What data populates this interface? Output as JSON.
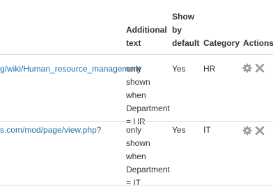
{
  "table": {
    "headers": {
      "url": "",
      "additional_text": "Additional text",
      "show_by_default": "Show by default",
      "category": "Category",
      "actions": "Actions"
    },
    "rows": [
      {
        "url": "g/wiki/Human_resource_management",
        "additional_text": "only shown when Department = HR",
        "show_by_default": "Yes",
        "category": "HR",
        "actions": [
          "gear-icon",
          "delete-icon"
        ]
      },
      {
        "url": "s.com/mod/page/view.php?",
        "additional_text": "only shown when Department = IT",
        "show_by_default": "Yes",
        "category": "IT",
        "actions": [
          "gear-icon",
          "delete-icon"
        ]
      }
    ]
  },
  "colors": {
    "link": "#1f6fa8",
    "text": "#333333",
    "icon": "#9a9a9a",
    "separator": "#dcdcdc"
  }
}
